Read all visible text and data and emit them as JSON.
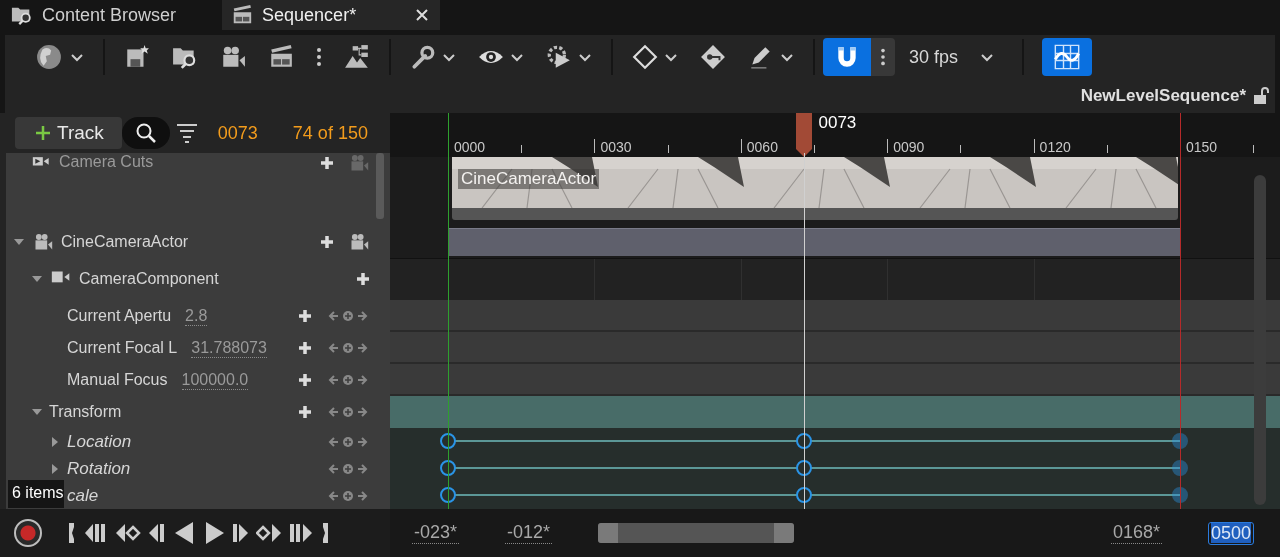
{
  "tabs": [
    {
      "label": "Content Browser",
      "selected": false
    },
    {
      "label": "Sequencer*",
      "selected": true
    }
  ],
  "toolbar": {
    "snap": {
      "on": true
    },
    "frame_rate": "30 fps",
    "curve_editor": {
      "on": true
    }
  },
  "sequence_name": "NewLevelSequence*",
  "outliner": {
    "add_track": "Track",
    "current_frame": "0073",
    "frame_count": "74 of 150",
    "tracks": [
      {
        "kind": "cuts",
        "label": "Camera Cuts"
      },
      {
        "kind": "actor",
        "label": "CineCameraActor",
        "expanded": true,
        "children": [
          {
            "kind": "component",
            "label": "CameraComponent",
            "expanded": true,
            "children": [
              {
                "kind": "property",
                "label": "Current Apertu",
                "value": "2.8"
              },
              {
                "kind": "property",
                "label": "Current Focal L",
                "value": "31.788073"
              },
              {
                "kind": "property",
                "label": "Manual Focus",
                "value": "100000.0"
              }
            ]
          },
          {
            "kind": "group",
            "label": "Transform",
            "expanded": true,
            "children": [
              {
                "kind": "channel",
                "label": "Location",
                "expanded": false,
                "keys": [
                  {
                    "level": 0,
                    "faded": false
                  },
                  {
                    "level": 0.487,
                    "faded": false
                  },
                  {
                    "level": 1,
                    "faded": true
                  }
                ]
              },
              {
                "kind": "channel",
                "label": "Rotation",
                "expanded": false,
                "keys": [
                  {
                    "level": 0,
                    "faded": false
                  },
                  {
                    "level": 0.487,
                    "faded": false
                  },
                  {
                    "level": 1,
                    "faded": true
                  }
                ]
              },
              {
                "kind": "channel",
                "label": "cale",
                "keys": [
                  {
                    "level": 0,
                    "faded": false
                  },
                  {
                    "level": 0.487,
                    "faded": false
                  },
                  {
                    "level": 1,
                    "faded": true
                  }
                ]
              }
            ]
          }
        ]
      }
    ],
    "tooltip": "6 items"
  },
  "timeline": {
    "ruler_labels": [
      "0000",
      "0030",
      "0060",
      "0090",
      "0120",
      "0150"
    ],
    "playhead": {
      "label": "0073",
      "level": 0.487
    },
    "cut_label": "CineCameraActor",
    "range_fields": [
      {
        "text": "-023*",
        "selected": false
      },
      {
        "text": "-012*",
        "selected": false
      },
      {
        "text": "0168*",
        "selected": false
      },
      {
        "text": "0500",
        "selected": true
      }
    ]
  }
}
